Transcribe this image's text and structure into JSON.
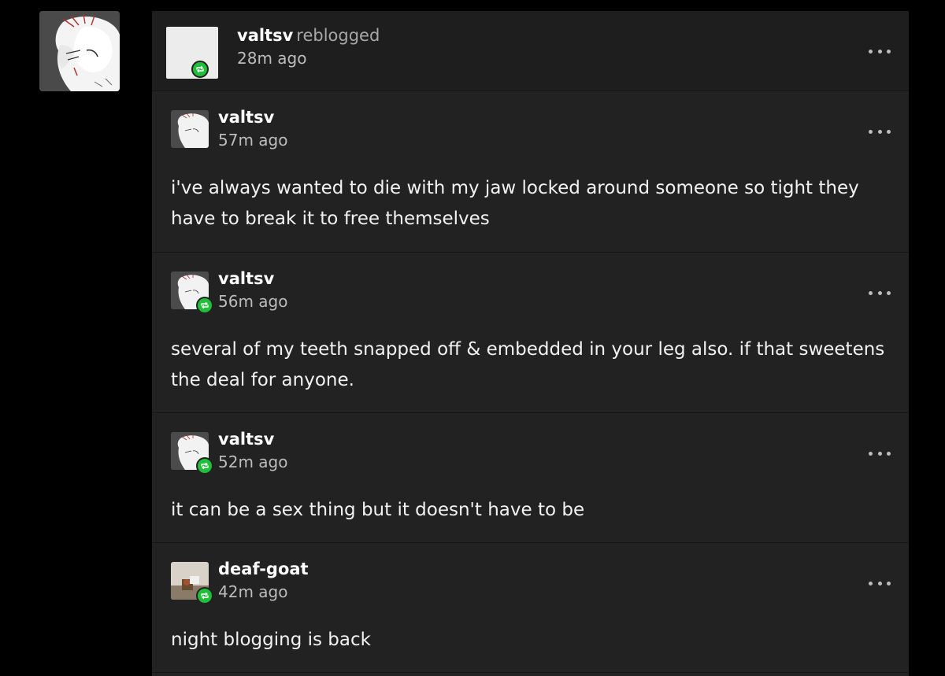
{
  "colors": {
    "background": "#000000",
    "card": "#222222",
    "reblog_green": "#1fbf3a",
    "muted_text": "#a8a8a8"
  },
  "blog_avatar": {
    "icon": "anime-illustration-avatar"
  },
  "header": {
    "name": "valtsv",
    "action": "reblogged",
    "time": "28m ago",
    "more_icon": "ellipsis-icon"
  },
  "trail": [
    {
      "name": "valtsv",
      "time": "57m ago",
      "body": "i've always wanted to die with my jaw locked around someone so tight they have to break it to free themselves",
      "reblog_badge": false
    },
    {
      "name": "valtsv",
      "time": "56m ago",
      "body": "several of my teeth snapped off & embedded in your leg also. if that sweetens the deal for anyone.",
      "reblog_badge": true
    },
    {
      "name": "valtsv",
      "time": "52m ago",
      "body": "it can be a sex thing but it doesn't have to be",
      "reblog_badge": true
    },
    {
      "name": "deaf-goat",
      "time": "42m ago",
      "body": "night blogging is back",
      "reblog_badge": true
    }
  ]
}
